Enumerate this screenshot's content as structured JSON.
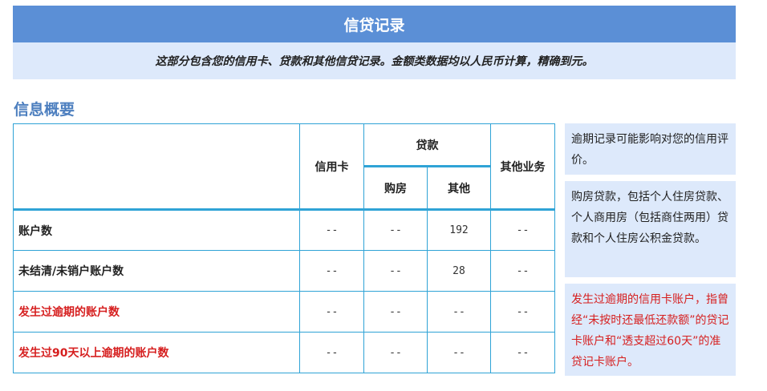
{
  "header": {
    "title": "信贷记录",
    "description": "这部分包含您的信用卡、贷款和其他信贷记录。金额类数据均以人民币计算，精确到元。"
  },
  "summary": {
    "section_title": "信息概要",
    "columns": {
      "credit_card": "信用卡",
      "loan": "贷款",
      "loan_housing": "购房",
      "loan_other": "其他",
      "other_business": "其他业务"
    },
    "rows": [
      {
        "label": "账户数",
        "credit_card": "--",
        "housing": "--",
        "other": "192",
        "other_business": "--",
        "highlight": false
      },
      {
        "label": "未结清/未销户账户数",
        "credit_card": "--",
        "housing": "--",
        "other": "28",
        "other_business": "--",
        "highlight": false
      },
      {
        "label": "发生过逾期的账户数",
        "credit_card": "--",
        "housing": "--",
        "other": "--",
        "other_business": "--",
        "highlight": true
      },
      {
        "label": "发生过90天以上逾期的账户数",
        "credit_card": "--",
        "housing": "--",
        "other": "--",
        "other_business": "--",
        "highlight": true
      }
    ]
  },
  "notes": [
    "逾期记录可能影响对您的信用评价。",
    "购房贷款，包括个人住房贷款、个人商用房（包括商住两用）贷款和个人住房公积金贷款。",
    "发生过逾期的信用卡账户，指曾经“未按时还最低还款额”的贷记卡账户和“透支超过60天”的准贷记卡账户。"
  ],
  "colors": {
    "header_bg": "#5b8fd6",
    "subheader_bg": "#dde9fb",
    "border": "#2fa3d6",
    "warning_text": "#d61f1f",
    "section_title": "#4d7fbf"
  }
}
